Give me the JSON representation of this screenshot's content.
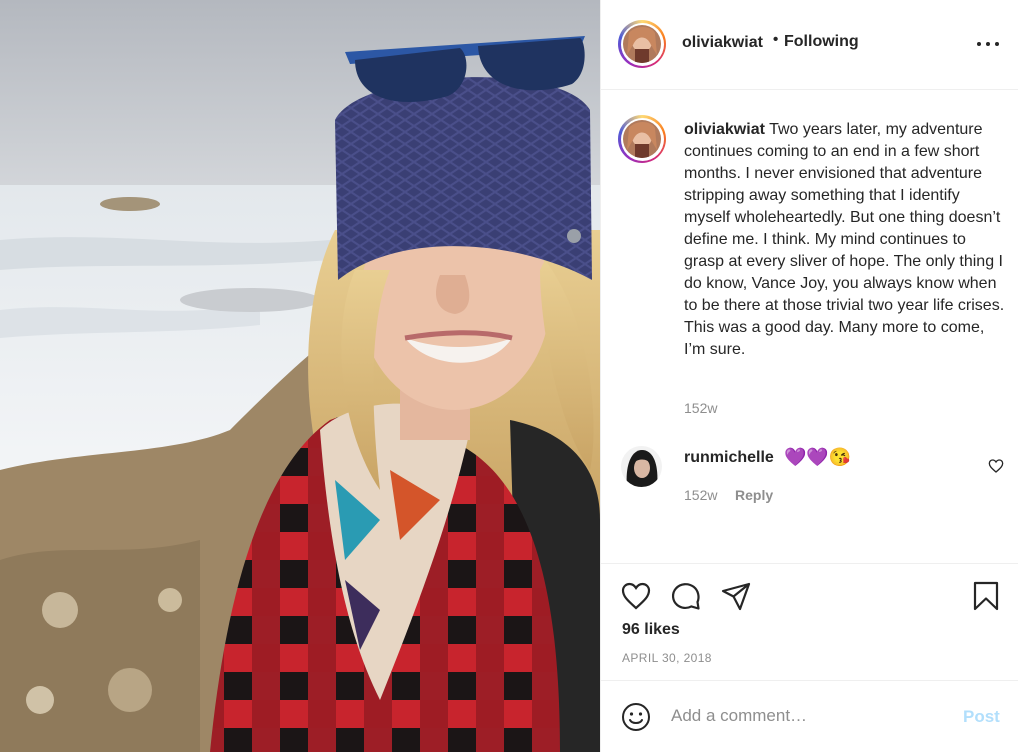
{
  "post": {
    "image_alt_description": "",
    "icons": [
      "heart-icon",
      "comment-icon",
      "share-icon",
      "bookmark-icon",
      "more-icon",
      "emoji-icon"
    ]
  },
  "header": {
    "username": "oliviakwiat",
    "separator": "•",
    "follow_status": "Following"
  },
  "caption": {
    "username": "oliviakwiat",
    "text": "Two years later, my adventure continues coming to an end in a few short months. I never envisioned that adventure stripping away something that I identify myself wholeheartedly. But one thing doesn’t define me. I think. My mind continues to grasp at every sliver of hope. The only thing I do know, Vance Joy, you always know when to be there at those trivial two year life crises. This was a good day. Many more to come, I’m sure.",
    "time": "152w"
  },
  "comments": [
    {
      "username": "runmichelle",
      "text": "💜💜😘",
      "time": "152w",
      "reply_label": "Reply"
    }
  ],
  "actions": {
    "likes": "96 likes",
    "date": "APRIL 30, 2018"
  },
  "add_comment": {
    "placeholder": "Add a comment…",
    "post_label": "Post"
  },
  "colors": {
    "text": "#262626",
    "secondary": "#8e8e8e",
    "post_disabled": "#b2dffc",
    "border": "#efefef"
  }
}
